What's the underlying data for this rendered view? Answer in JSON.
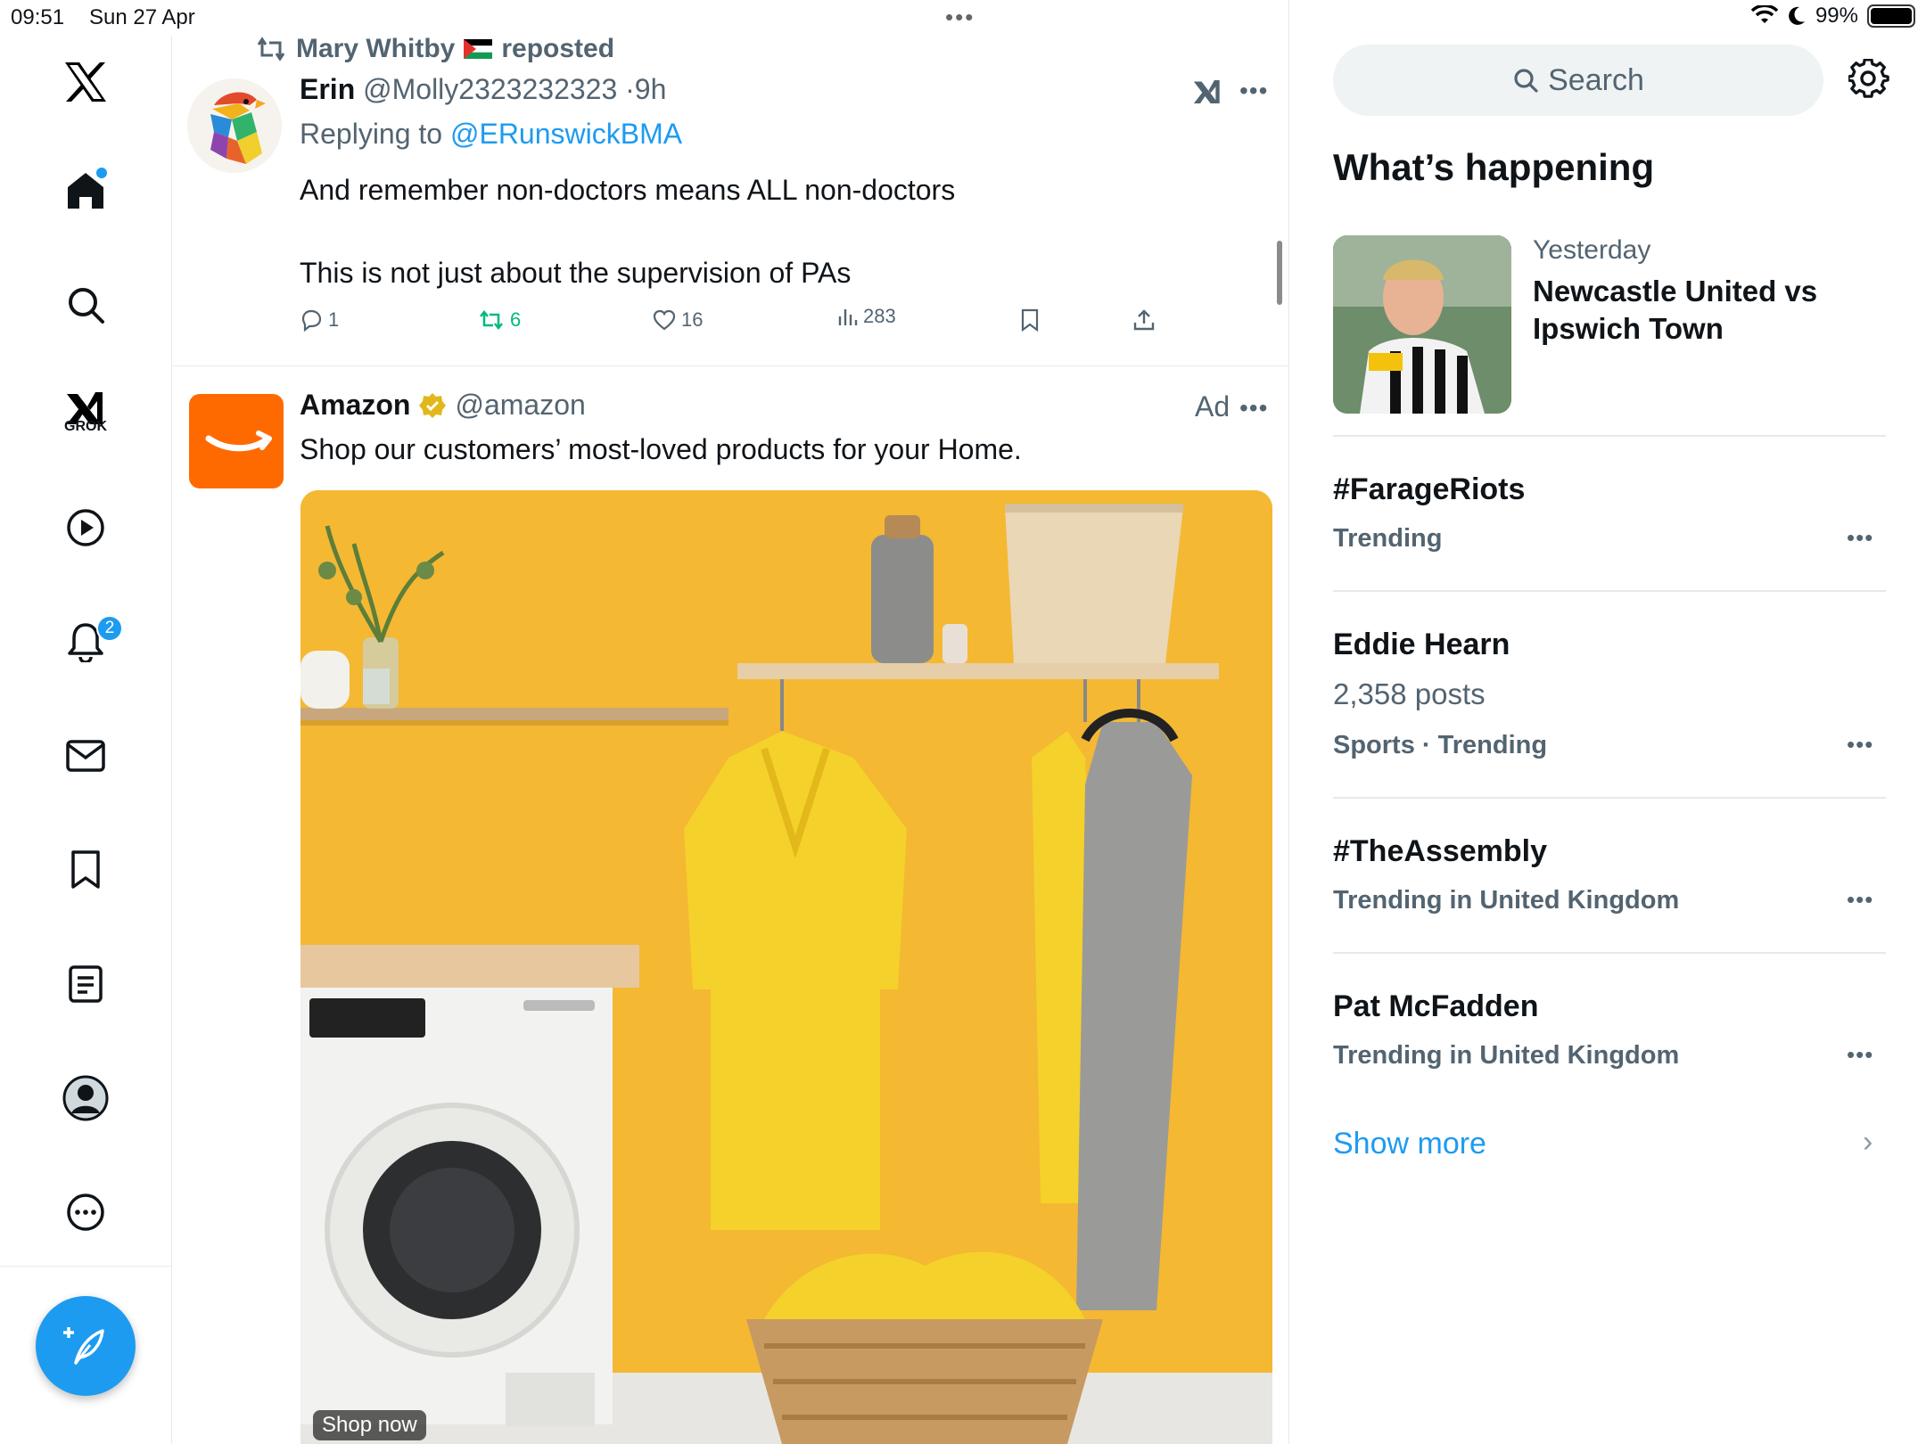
{
  "status_bar": {
    "time": "09:51",
    "date": "Sun 27 Apr",
    "battery": "99%",
    "battery_level": 0.99
  },
  "nav": {
    "items": [
      "home",
      "explore",
      "grok",
      "video",
      "notifications",
      "messages",
      "bookmarks",
      "lists",
      "profile",
      "more"
    ],
    "grok_label": "GROK",
    "notifications_badge": "2"
  },
  "feed": {
    "tweet": {
      "repost_by": "Mary Whitby",
      "repost_suffix": "reposted",
      "author_name": "Erin",
      "author_handle": "@Molly2323232323",
      "time": "9h",
      "separator": "·",
      "replying_prefix": "Replying to",
      "replying_to": "@ERunswickBMA",
      "text_line1": "And remember non-doctors means ALL non-doctors",
      "text_line2": "This is not just about the supervision of PAs",
      "replies": "1",
      "reposts": "6",
      "likes": "16",
      "views": "283"
    },
    "ad": {
      "name": "Amazon",
      "handle": "@amazon",
      "label": "Ad",
      "text": "Shop our customers’ most-loved products for your Home.",
      "cta": "Shop now"
    }
  },
  "sidebar": {
    "search_placeholder": "Search",
    "title": "What’s happening",
    "news": {
      "when": "Yesterday",
      "title": "Newcastle United vs Ipswich Town"
    },
    "trends": [
      {
        "title": "#FarageRiots",
        "sub": "Trending"
      },
      {
        "title": "Eddie Hearn",
        "count": "2,358 posts",
        "sub": "Sports · Trending"
      },
      {
        "title": "#TheAssembly",
        "sub": "Trending in United Kingdom"
      },
      {
        "title": "Pat McFadden",
        "sub": "Trending in United Kingdom"
      }
    ],
    "show_more": "Show more"
  },
  "colors": {
    "accent": "#1d9bf0",
    "muted": "#536471",
    "repost_green": "#00ba7c",
    "amazon_orange": "#ff6a00",
    "ad_background": "#f4b833"
  }
}
